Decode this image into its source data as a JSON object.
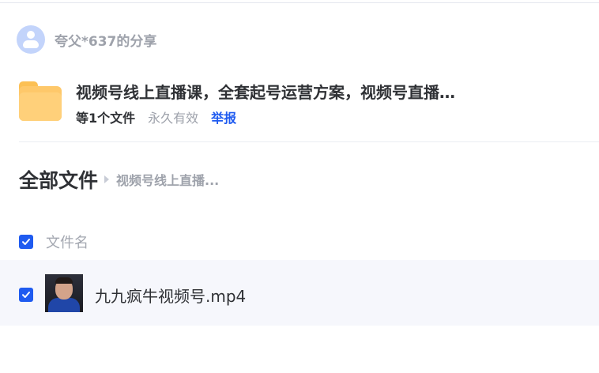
{
  "share": {
    "sharer_name": "夸父*637的分享",
    "folder_title": "视频号线上直播课，全套起号运营方案，视频号直播…",
    "file_count": "等1个文件",
    "validity": "永久有效",
    "report_label": "举报"
  },
  "breadcrumb": {
    "root": "全部文件",
    "current": "视频号线上直播..."
  },
  "file_list": {
    "column_name": "文件名",
    "header_checked": true,
    "rows": [
      {
        "name": "九九疯牛视频号.mp4",
        "checked": true,
        "icon": "video-thumbnail"
      }
    ]
  },
  "colors": {
    "accent": "#1f5bf0",
    "folder": "#fec86a",
    "row_highlight": "#f6f7fc"
  }
}
